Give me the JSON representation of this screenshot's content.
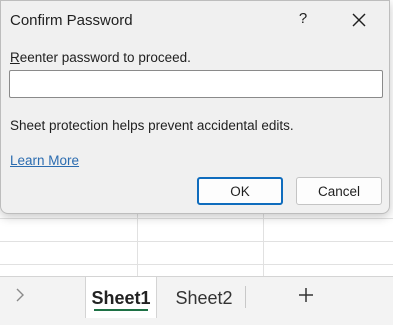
{
  "dialog": {
    "title": "Confirm Password",
    "help_label": "?",
    "close_icon": "close-icon",
    "prompt_access_key": "R",
    "prompt_rest": "eenter password to proceed.",
    "password_value": "",
    "info_text": "Sheet protection helps prevent accidental edits.",
    "learn_more_label": "Learn More",
    "ok_label": "OK",
    "cancel_label": "Cancel",
    "colors": {
      "background": "#f0f0f0",
      "link": "#2b6cb0",
      "default_button_border": "#0f6cbd"
    }
  },
  "sheet_tabs": {
    "nav_icon": "chevron-right-icon",
    "tabs": [
      {
        "label": "Sheet1",
        "active": true
      },
      {
        "label": "Sheet2",
        "active": false
      }
    ],
    "add_icon": "plus-icon",
    "active_underline_color": "#1e7145"
  }
}
